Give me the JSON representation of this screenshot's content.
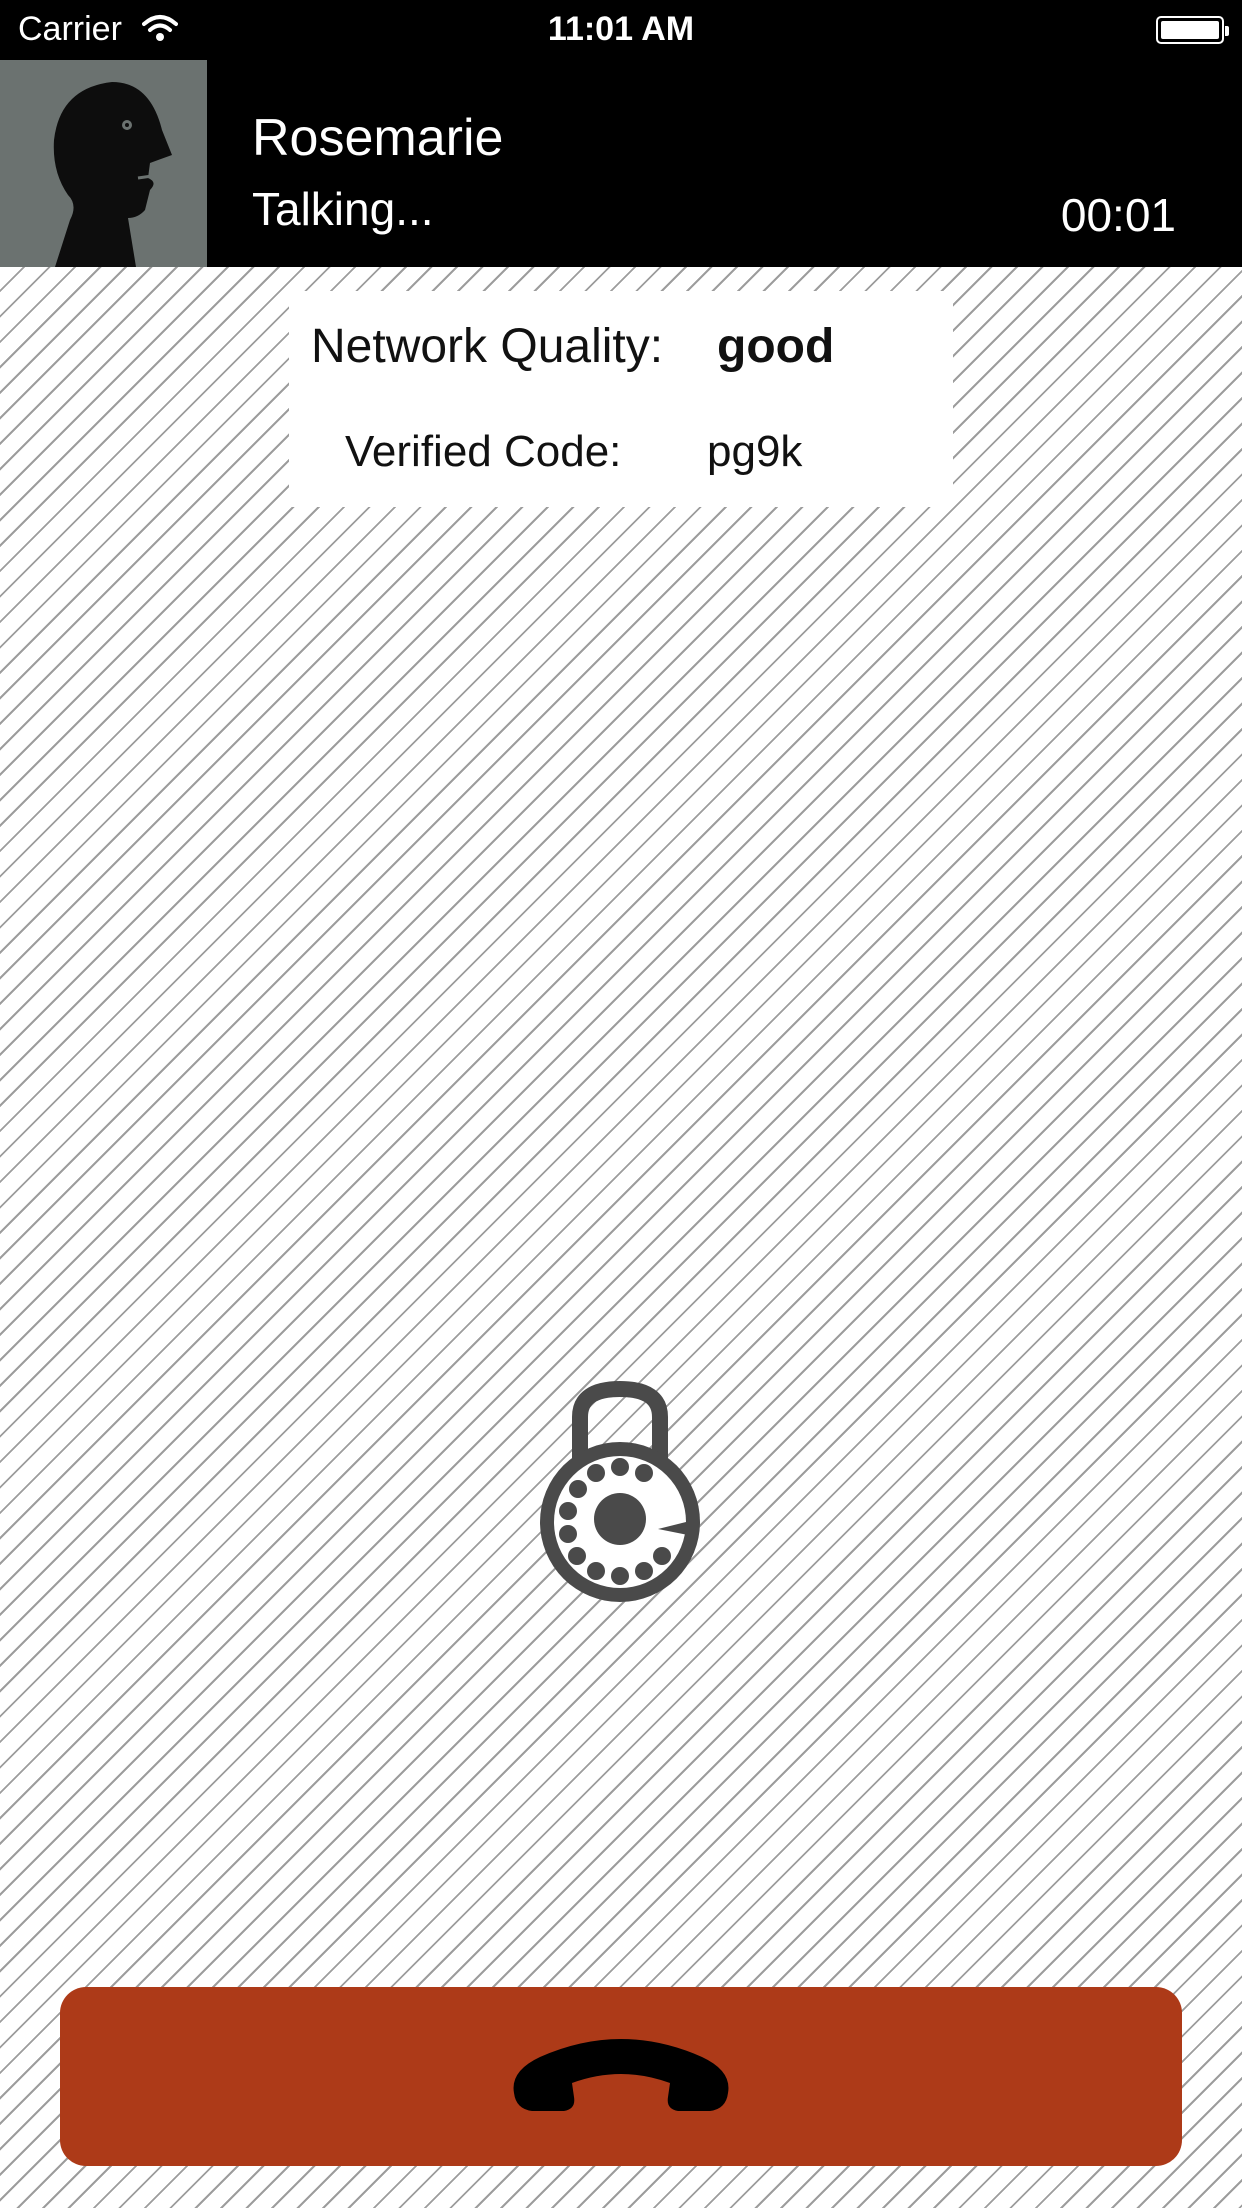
{
  "status_bar": {
    "carrier": "Carrier",
    "time": "11:01 AM"
  },
  "call": {
    "contact_name": "Rosemarie",
    "status": "Talking...",
    "duration": "00:01"
  },
  "info": {
    "network_quality_label": "Network Quality:",
    "network_quality_value": "good",
    "verified_code_label": "Verified Code:",
    "verified_code_value": "pg9k"
  },
  "icons": {
    "avatar": "person-silhouette-icon",
    "lock": "rotary-dial-lock-icon",
    "hangup": "phone-handset-icon"
  },
  "colors": {
    "header_bg": "#000000",
    "avatar_bg": "#6b7270",
    "hangup_bg": "#ad3a18",
    "icon_gray": "#4a4a4a"
  }
}
